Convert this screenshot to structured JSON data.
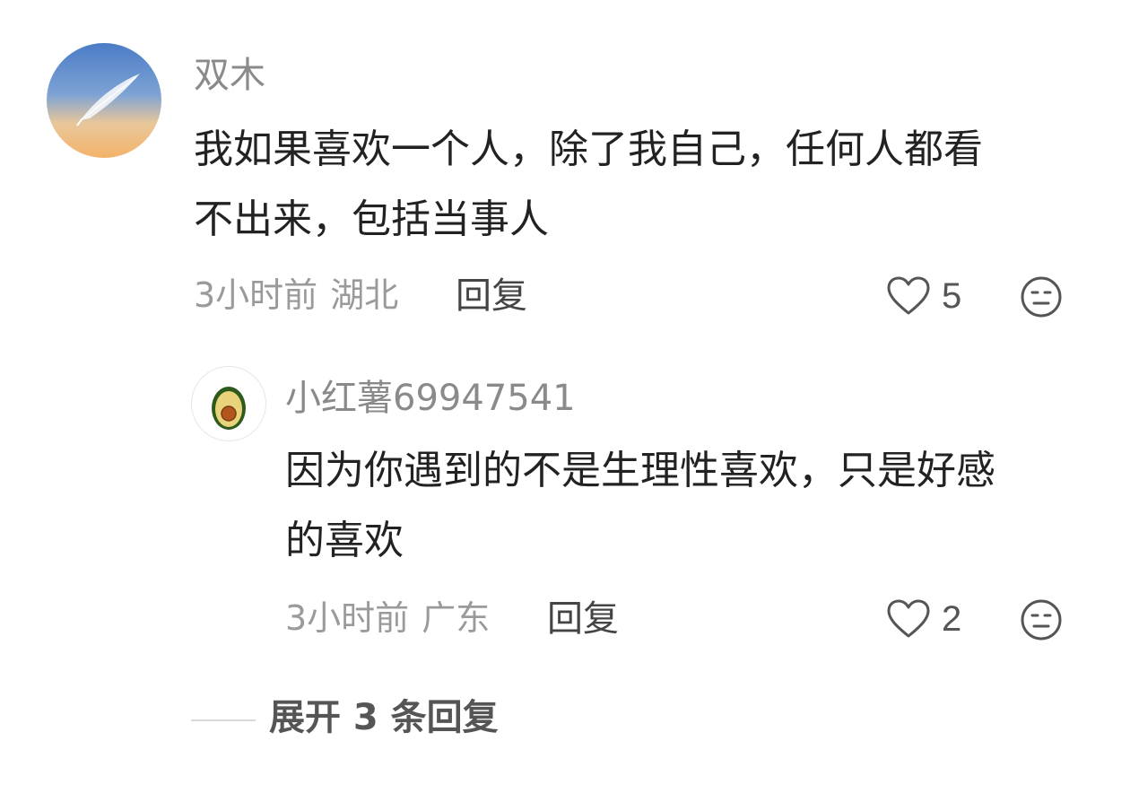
{
  "comment": {
    "username": "双木",
    "text_line1": "我如果喜欢一个人，除了我自己，任何人都看",
    "text_line2": "不出来，包括当事人",
    "time": "3小时前",
    "location": "湖北",
    "reply_label": "回复",
    "likes": "5",
    "avatar_icon": "feather-avatar"
  },
  "reply": {
    "username": "小红薯69947541",
    "text_line1": "因为你遇到的不是生理性喜欢，只是好感",
    "text_line2": "的喜欢",
    "time": "3小时前",
    "location": "广东",
    "reply_label": "回复",
    "likes": "2",
    "avatar_icon": "avocado-avatar"
  },
  "expand_replies_label": "展开 3 条回复",
  "colors": {
    "username": "#8a8a8a",
    "text": "#222222",
    "meta": "#9a9a9a",
    "reply": "#444444"
  }
}
